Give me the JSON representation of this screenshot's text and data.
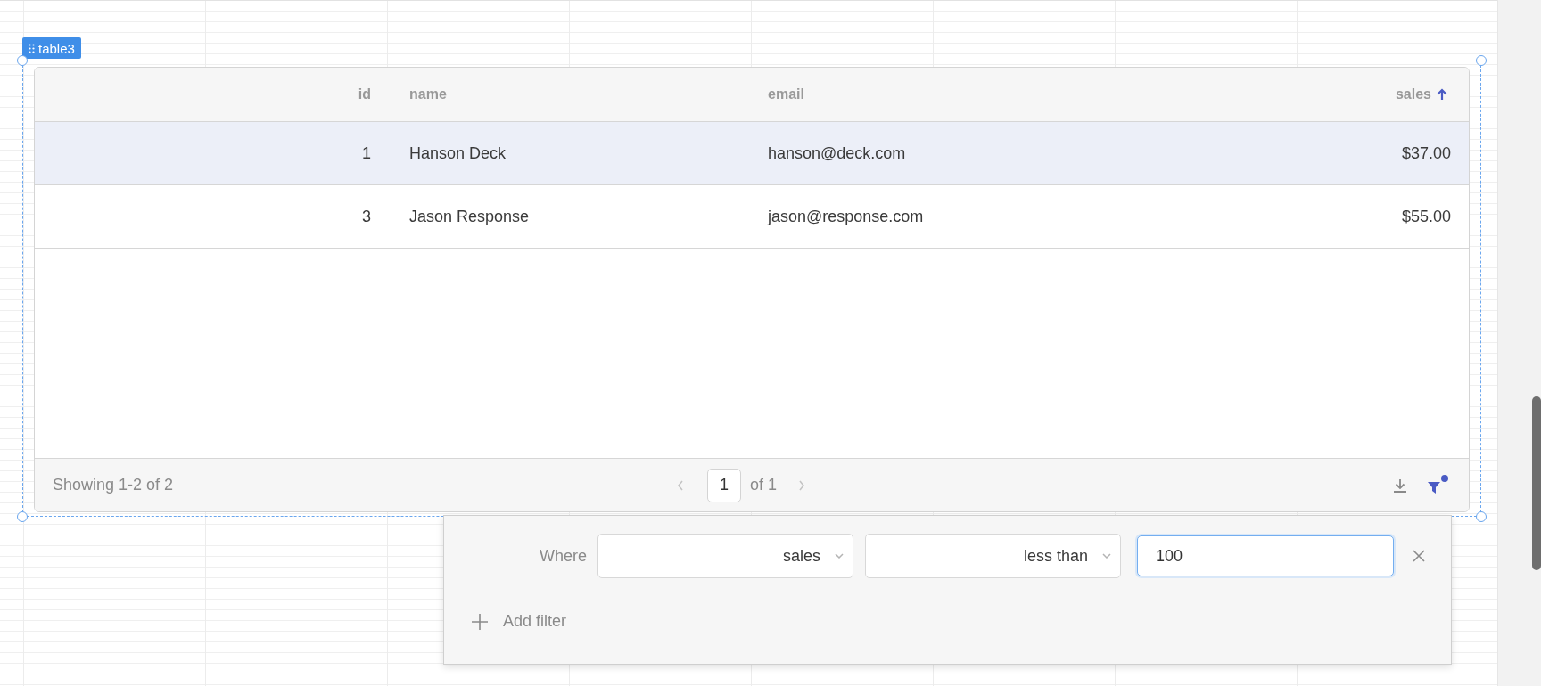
{
  "component_label": "table3",
  "table": {
    "columns": [
      {
        "label": "id",
        "sorted": false
      },
      {
        "label": "name",
        "sorted": false
      },
      {
        "label": "email",
        "sorted": false
      },
      {
        "label": "sales",
        "sorted": true
      }
    ],
    "rows": [
      {
        "cells": [
          "1",
          "Hanson Deck",
          "hanson@deck.com",
          "$37.00"
        ],
        "selected": true
      },
      {
        "cells": [
          "3",
          "Jason Response",
          "jason@response.com",
          "$55.00"
        ],
        "selected": false
      }
    ],
    "footer": {
      "summary": "Showing 1-2 of 2",
      "page": "1",
      "page_total": "of 1",
      "filter_active": true
    }
  },
  "filter_panel": {
    "where_label": "Where",
    "filters": [
      {
        "column": "sales",
        "operator": "less than",
        "value": "100"
      }
    ],
    "add_label": "Add filter"
  }
}
